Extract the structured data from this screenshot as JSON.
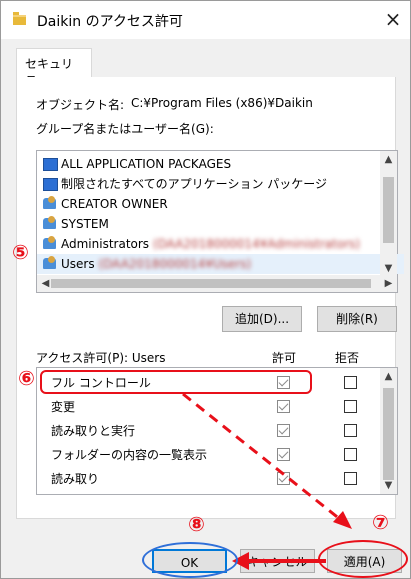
{
  "window": {
    "title": "Daikin のアクセス許可",
    "close_glyph": "×"
  },
  "tabs": [
    {
      "label": "セキュリティ"
    }
  ],
  "object": {
    "label": "オブジェクト名:",
    "value": "C:¥Program Files (x86)¥Daikin"
  },
  "group_label": "グループ名またはユーザー名(G):",
  "groups": [
    {
      "name": "ALL APPLICATION PACKAGES",
      "icon": "package-icon",
      "suffix": ""
    },
    {
      "name": "制限されたすべてのアプリケーション パッケージ",
      "icon": "package-icon",
      "suffix": ""
    },
    {
      "name": "CREATOR OWNER",
      "icon": "user-group-icon",
      "suffix": ""
    },
    {
      "name": "SYSTEM",
      "icon": "user-group-icon",
      "suffix": ""
    },
    {
      "name": "Administrators",
      "icon": "user-group-icon",
      "suffix": "(DAA2018000014¥Administrators)"
    },
    {
      "name": "Users",
      "icon": "user-group-icon",
      "suffix": "(DAA2018000014¥Users)"
    }
  ],
  "buttons": {
    "add": "追加(D)...",
    "remove": "削除(R)",
    "ok": "OK",
    "cancel": "キャンセル",
    "apply": "適用(A)"
  },
  "permissions": {
    "label": "アクセス許可(P): Users",
    "allow_header": "許可",
    "deny_header": "拒否",
    "rows": [
      {
        "name": "フル コントロール",
        "allow": true,
        "deny": false
      },
      {
        "name": "変更",
        "allow": true,
        "deny": false
      },
      {
        "name": "読み取りと実行",
        "allow": true,
        "deny": false
      },
      {
        "name": "フォルダーの内容の一覧表示",
        "allow": true,
        "deny": false
      },
      {
        "name": "読み取り",
        "allow": true,
        "deny": false
      }
    ]
  },
  "annotations": {
    "step5": "⑤",
    "step6": "⑥",
    "step7": "⑦",
    "step8": "⑧",
    "color_red": "#e8101a",
    "color_blue": "#2f6fd8"
  }
}
